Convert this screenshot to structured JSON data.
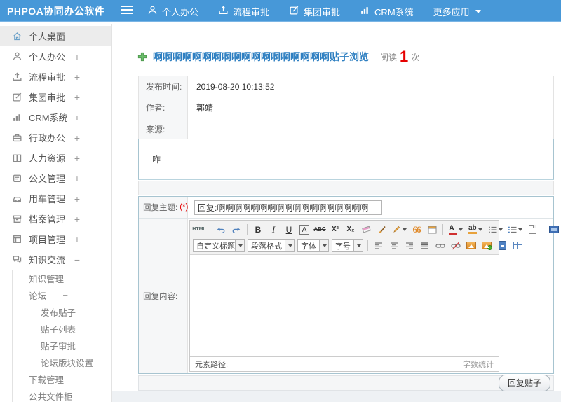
{
  "header": {
    "logo": "PHPOA协同办公软件",
    "nav": [
      {
        "label": "个人办公"
      },
      {
        "label": "流程审批"
      },
      {
        "label": "集团审批"
      },
      {
        "label": "CRM系统"
      },
      {
        "label": "更多应用"
      }
    ]
  },
  "sidebar": {
    "items": [
      {
        "label": "个人桌面",
        "expander": ""
      },
      {
        "label": "个人办公",
        "expander": "+"
      },
      {
        "label": "流程审批",
        "expander": "+"
      },
      {
        "label": "集团审批",
        "expander": "+"
      },
      {
        "label": "CRM系统",
        "expander": "+"
      },
      {
        "label": "行政办公",
        "expander": "+"
      },
      {
        "label": "人力资源",
        "expander": "+"
      },
      {
        "label": "公文管理",
        "expander": "+"
      },
      {
        "label": "用车管理",
        "expander": "+"
      },
      {
        "label": "档案管理",
        "expander": "+"
      },
      {
        "label": "项目管理",
        "expander": "+"
      },
      {
        "label": "知识交流",
        "expander": "−"
      }
    ],
    "knowledge_child": "知识管理",
    "forum": {
      "label": "论坛",
      "expander": "−"
    },
    "forum_children": [
      "发布贴子",
      "贴子列表",
      "贴子审批",
      "论坛版块设置"
    ],
    "knowledge_tail": [
      "下载管理",
      "公共文件柜"
    ]
  },
  "main": {
    "title": "啊啊啊啊啊啊啊啊啊啊啊啊啊啊啊啊啊啊贴子浏览",
    "read_label": "阅读",
    "read_count": "1",
    "read_unit": "次",
    "info_rows": [
      {
        "label": "发布时间:",
        "value": "2019-08-20 10:13:52"
      },
      {
        "label": "作者:",
        "value": "郭靖"
      },
      {
        "label": "来源:",
        "value": ""
      }
    ],
    "post_content": "咋",
    "reply": {
      "subject_label": "回复主题:",
      "required_mark": "(*)",
      "subject_value": "回复:啊啊啊啊啊啊啊啊啊啊啊啊啊啊啊啊啊啊",
      "content_label": "回复内容:",
      "submit_label": "回复贴子"
    },
    "editor": {
      "g": {
        "html": "HTML",
        "bold": "B",
        "italic": "I",
        "underline": "U",
        "fontbox": "A",
        "strike": "ABC",
        "sup": "X²",
        "sub": "X₂",
        "quote": "66",
        "forecolor": "A",
        "hilite": "ab"
      },
      "dropdowns": [
        "自定义标题",
        "段落格式",
        "字体",
        "字号"
      ],
      "status_left": "元素路径:",
      "status_right": "字数统计"
    }
  },
  "colors": {
    "header_blue": "#4798d8",
    "title_blue": "#2e7fc1",
    "count_red": "#e60000",
    "panel_border": "#a7c4d0"
  }
}
